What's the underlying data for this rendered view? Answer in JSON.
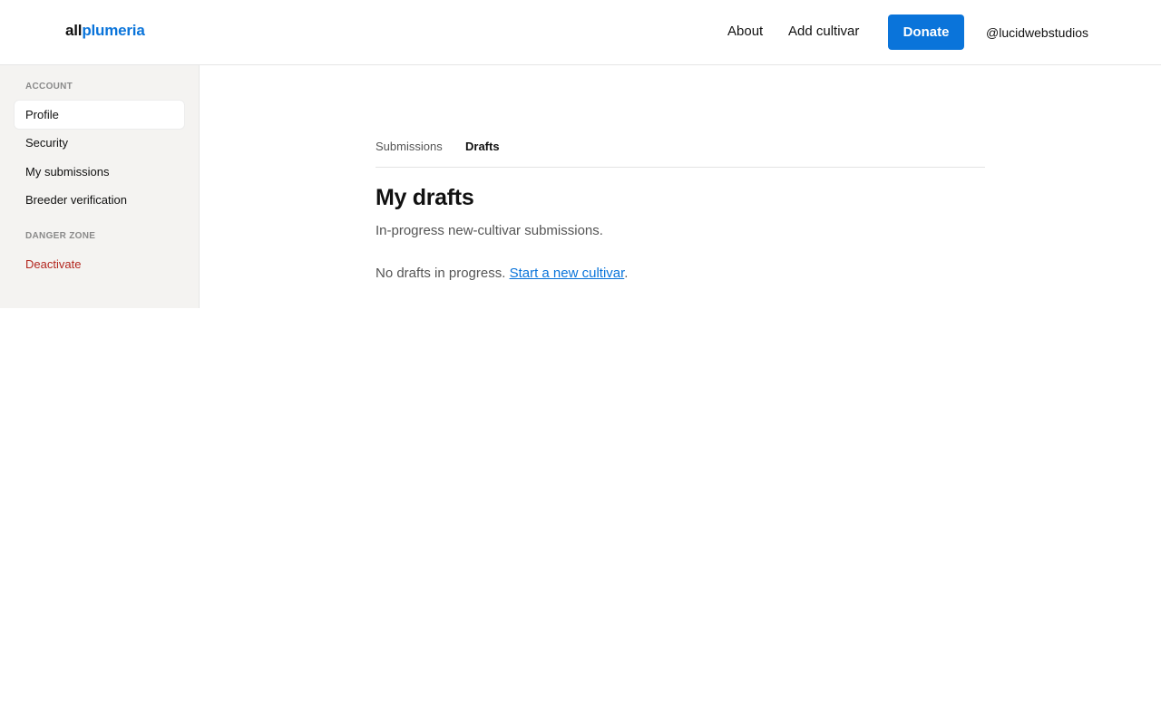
{
  "header": {
    "logo_part1": "all",
    "logo_part2": "plumeria",
    "nav": {
      "about": "About",
      "add_cultivar": "Add cultivar"
    },
    "donate_label": "Donate",
    "username": "@lucidwebstudios"
  },
  "sidebar": {
    "account_heading": "ACCOUNT",
    "items": [
      {
        "label": "Profile"
      },
      {
        "label": "Security"
      },
      {
        "label": "My submissions"
      },
      {
        "label": "Breeder verification"
      }
    ],
    "danger_heading": "DANGER ZONE",
    "danger_items": [
      {
        "label": "Deactivate"
      }
    ]
  },
  "main": {
    "tabs": [
      {
        "label": "Submissions"
      },
      {
        "label": "Drafts"
      }
    ],
    "title": "My drafts",
    "subtitle": "In-progress new-cultivar submissions.",
    "empty_text": "No drafts in progress. ",
    "empty_link": "Start a new cultivar",
    "empty_suffix": "."
  },
  "colors": {
    "accent": "#0a74da",
    "danger": "#b3261e",
    "sidebar_bg": "#f4f3f1"
  }
}
